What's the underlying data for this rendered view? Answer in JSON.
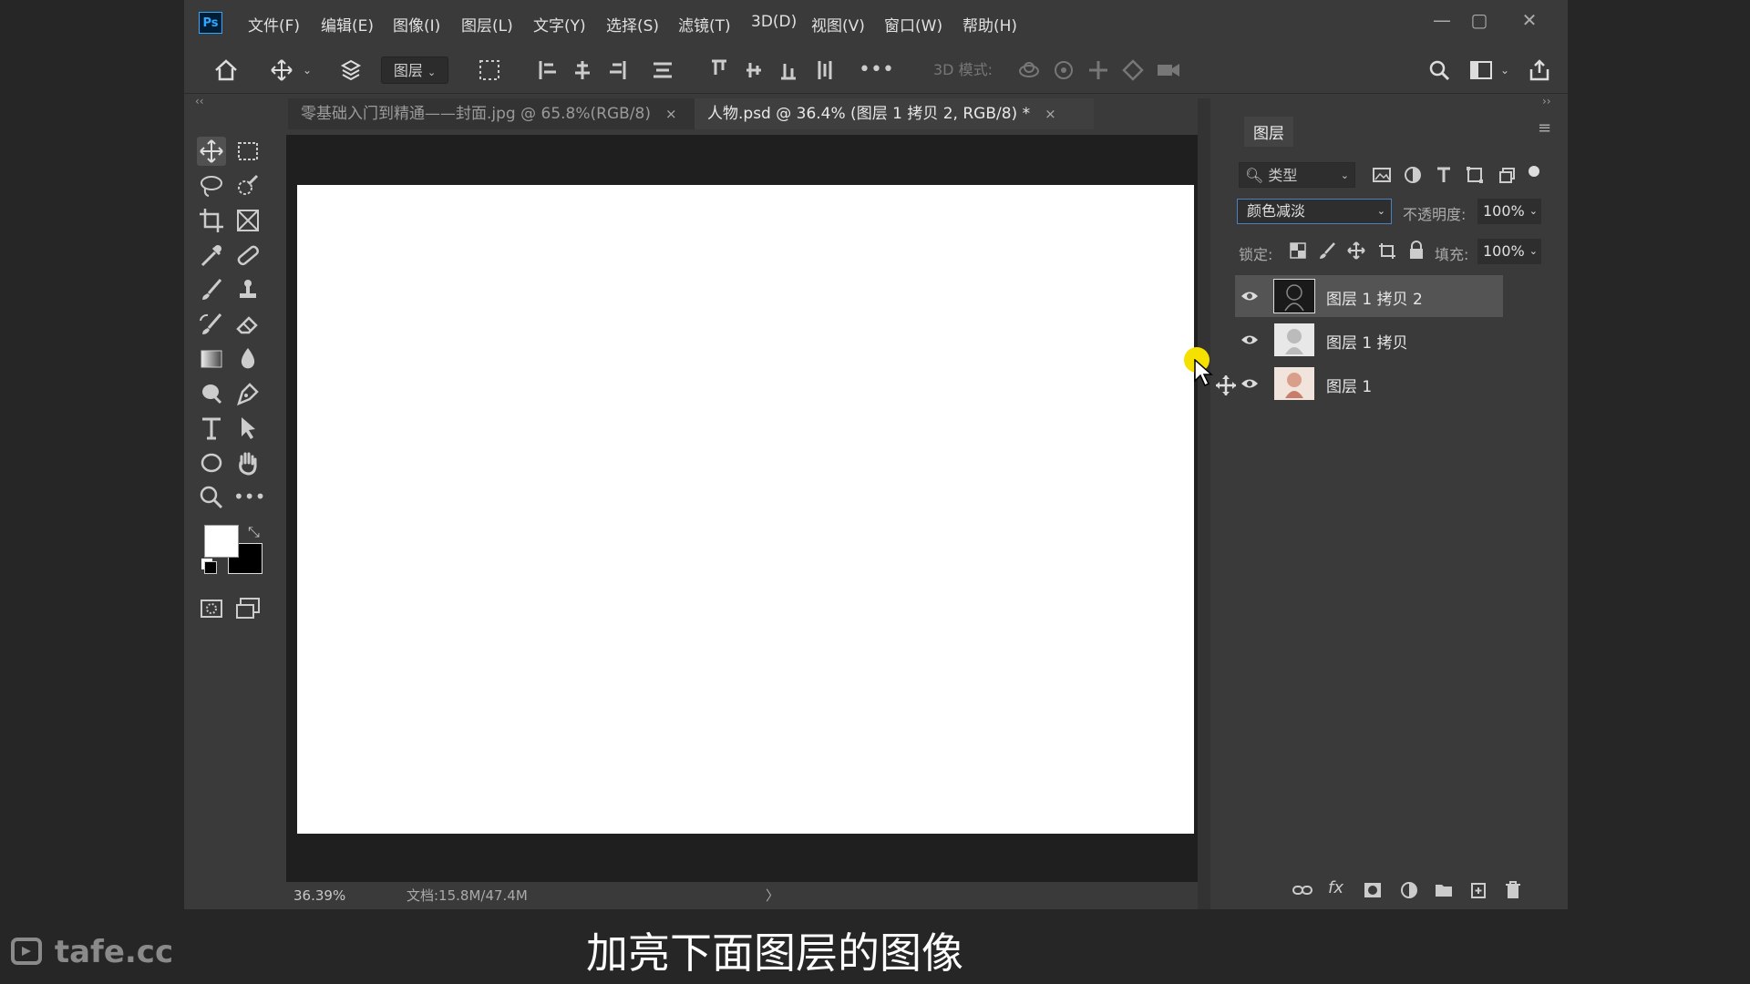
{
  "menubar": {
    "logo": "Ps",
    "items": [
      "文件(F)",
      "编辑(E)",
      "图像(I)",
      "图层(L)",
      "文字(Y)",
      "选择(S)",
      "滤镜(T)",
      "3D(D)",
      "视图(V)",
      "窗口(W)",
      "帮助(H)"
    ]
  },
  "optionsbar": {
    "auto_select_target": "图层",
    "mode3d_label": "3D 模式:"
  },
  "tabs": [
    {
      "label": "零基础入门到精通——封面.jpg @ 65.8%(RGB/8)",
      "close": "×"
    },
    {
      "label": "人物.psd @ 36.4% (图层 1 拷贝 2, RGB/8) *",
      "close": "×"
    }
  ],
  "status": {
    "zoom": "36.39%",
    "doc_info": "文档:15.8M/47.4M",
    "arrow": "〉"
  },
  "layers_panel": {
    "title": "图层",
    "filter_kind": "类型",
    "blend_mode": "颜色减淡",
    "opacity_label": "不透明度:",
    "opacity_value": "100%",
    "lock_label": "锁定:",
    "fill_label": "填充:",
    "fill_value": "100%",
    "layers": [
      {
        "name": "图层 1 拷贝 2",
        "selected": true,
        "thumb": "#1a1a1a"
      },
      {
        "name": "图层 1 拷贝",
        "selected": false,
        "thumb": "#e8e8e8"
      },
      {
        "name": "图层 1",
        "selected": false,
        "thumb": "#f1e4dc"
      }
    ]
  },
  "subtitle": "加亮下面图层的图像",
  "watermark": "tafe.cc",
  "colors": {
    "app_bg": "#3a3a3a",
    "canvas_bg": "#1f1f1f",
    "foreground": "#ffffff",
    "background": "#000000",
    "cursor_highlight": "#f5e000"
  }
}
